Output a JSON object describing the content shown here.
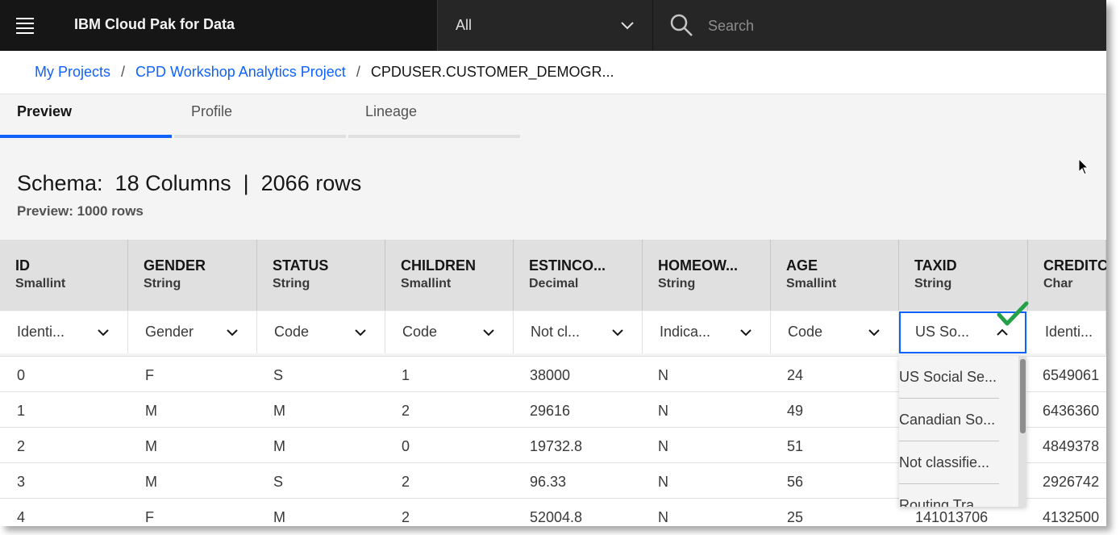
{
  "header": {
    "brand": "IBM Cloud Pak for Data",
    "scope": "All",
    "search_placeholder": "Search"
  },
  "breadcrumb": {
    "items": [
      "My Projects",
      "CPD Workshop Analytics Project"
    ],
    "separator": "/",
    "current": "CPDUSER.CUSTOMER_DEMOGR..."
  },
  "tabs": [
    {
      "label": "Preview",
      "active": true
    },
    {
      "label": "Profile",
      "active": false
    },
    {
      "label": "Lineage",
      "active": false
    }
  ],
  "schema": {
    "text": "Schema:  18 Columns  |  2066 rows",
    "preview": "Preview: 1000 rows"
  },
  "columns": [
    {
      "name": "ID",
      "type": "Smallint",
      "class": "Identi..."
    },
    {
      "name": "GENDER",
      "type": "String",
      "class": "Gender"
    },
    {
      "name": "STATUS",
      "type": "String",
      "class": "Code"
    },
    {
      "name": "CHILDREN",
      "type": "Smallint",
      "class": "Code"
    },
    {
      "name": "ESTINCO...",
      "type": "Decimal",
      "class": "Not cl..."
    },
    {
      "name": "HOMEOW...",
      "type": "String",
      "class": "Indica..."
    },
    {
      "name": "AGE",
      "type": "Smallint",
      "class": "Code"
    },
    {
      "name": "TAXID",
      "type": "String",
      "class": "US So..."
    },
    {
      "name": "CREDITC",
      "type": "Char",
      "class": "Identi..."
    }
  ],
  "rows": [
    [
      "0",
      "F",
      "S",
      "1",
      "38000",
      "N",
      "24",
      "",
      "6549061"
    ],
    [
      "1",
      "M",
      "M",
      "2",
      "29616",
      "N",
      "49",
      "",
      "6436360"
    ],
    [
      "2",
      "M",
      "M",
      "0",
      "19732.8",
      "N",
      "51",
      "",
      "4849378"
    ],
    [
      "3",
      "M",
      "S",
      "2",
      "96.33",
      "N",
      "56",
      "",
      "2926742"
    ],
    [
      "4",
      "F",
      "M",
      "2",
      "52004.8",
      "N",
      "25",
      "141013706",
      "4132500"
    ]
  ],
  "dropdown": {
    "options": [
      "US Social Se...",
      "Canadian So...",
      "Not classifie...",
      "Routing Tra..."
    ]
  },
  "colors": {
    "accent": "#0f62fe",
    "topbar": "#161616",
    "check": "#24a148"
  }
}
